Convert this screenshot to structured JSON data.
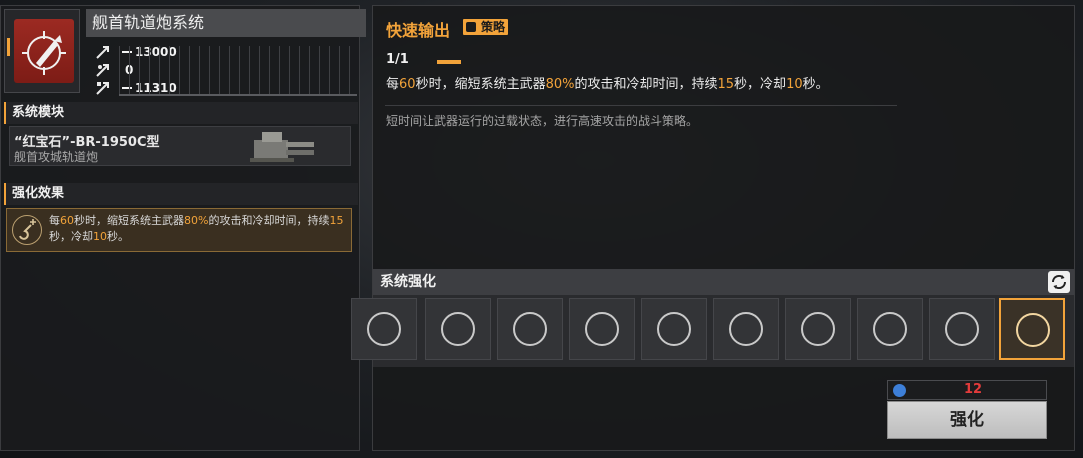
{
  "system": {
    "title": "舰首轨道炮系统",
    "stats": [
      {
        "icon": "attack-up-icon",
        "value": "13000"
      },
      {
        "icon": "attack-mid-icon",
        "value": "0"
      },
      {
        "icon": "attack-low-icon",
        "value": "11310"
      }
    ]
  },
  "module": {
    "heading": "系统模块",
    "name": "“红宝石”-BR-1950C型",
    "subtitle": "舰首攻城轨道炮"
  },
  "effect": {
    "heading": "强化效果",
    "text_parts": [
      "每",
      "60",
      "秒时，缩短系统主武器",
      "80%",
      "的攻击和冷却时间，持续",
      "15",
      "秒，冷却",
      "10",
      "秒。"
    ]
  },
  "skill": {
    "name": "快速输出",
    "tag": "策略",
    "level": "1/1",
    "desc_parts": [
      "每",
      "60",
      "秒时，缩短系统主武器",
      "80%",
      "的攻击和冷却时间，持续",
      "15",
      "秒，冷却",
      "10",
      "秒。"
    ],
    "flavor": "短时间让武器运行的过载状态，进行高速攻击的战斗策略。"
  },
  "enhance": {
    "heading": "系统强化",
    "slots": [
      {
        "icon": "missile-up-icon",
        "active": false
      },
      {
        "icon": "missile-boost-icon",
        "active": false
      },
      {
        "icon": "radar-spin-icon",
        "active": false
      },
      {
        "icon": "radar-sweep-icon",
        "active": false
      },
      {
        "icon": "triple-arrow-icon",
        "active": false
      },
      {
        "icon": "shield-hex-icon",
        "active": false
      },
      {
        "icon": "burst-crown-icon",
        "active": false
      },
      {
        "icon": "anvil-icon",
        "active": false
      },
      {
        "icon": "cube-shield-icon",
        "active": false
      },
      {
        "icon": "guitar-plus-icon",
        "active": true
      }
    ],
    "cost": "12",
    "button": "强化"
  },
  "colors": {
    "accent": "#f2a33a",
    "cost_red": "#e23b3b"
  }
}
